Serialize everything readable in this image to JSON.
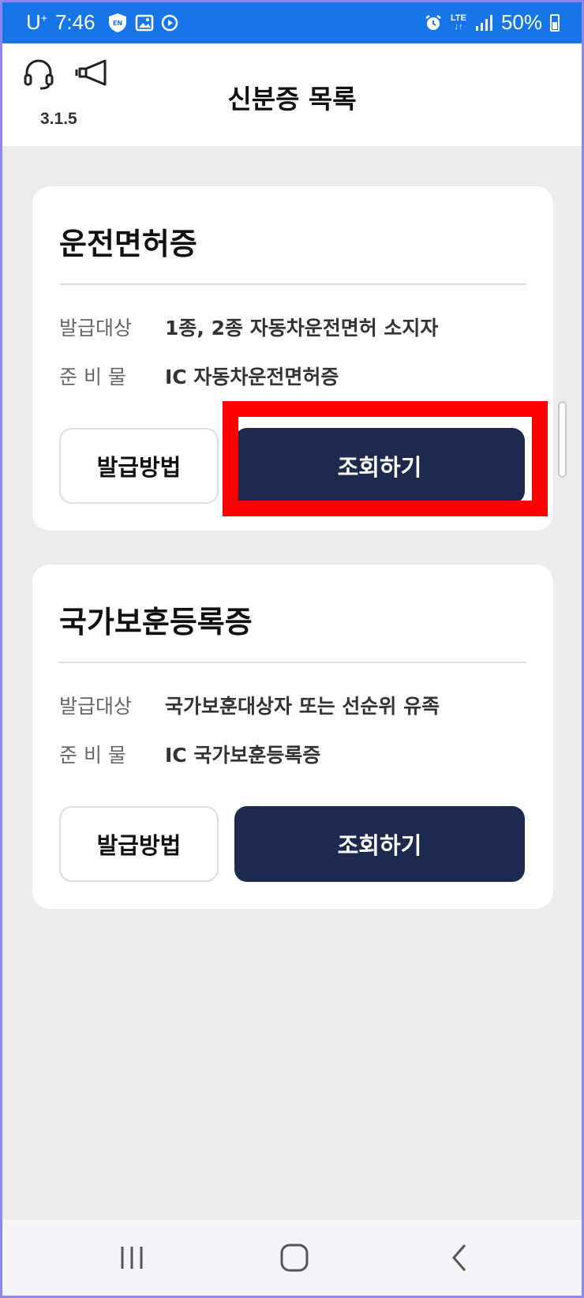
{
  "status_bar": {
    "carrier": "U",
    "carrier_sup": "+",
    "time": "7:46",
    "network": "LTE",
    "battery": "50%"
  },
  "header": {
    "version": "3.1.5",
    "title": "신분증 목록",
    "icons": [
      "headset-icon",
      "megaphone-icon"
    ]
  },
  "cards": [
    {
      "title": "운전면허증",
      "rows": [
        {
          "label": "발급대상",
          "value": "1종, 2종 자동차운전면허 소지자"
        },
        {
          "label": "준 비 물",
          "value": "IC 자동차운전면허증"
        }
      ],
      "method_button": "발급방법",
      "view_button": "조회하기"
    },
    {
      "title": "국가보훈등록증",
      "rows": [
        {
          "label": "발급대상",
          "value": "국가보훈대상자 또는 선순위 유족"
        },
        {
          "label": "준 비 물",
          "value": "IC 국가보훈등록증"
        }
      ],
      "method_button": "발급방법",
      "view_button": "조회하기"
    }
  ],
  "colors": {
    "status_bar": "#1775ea",
    "primary_button": "#1d2a4e",
    "highlight": "#ff0000",
    "background": "#ececec"
  }
}
